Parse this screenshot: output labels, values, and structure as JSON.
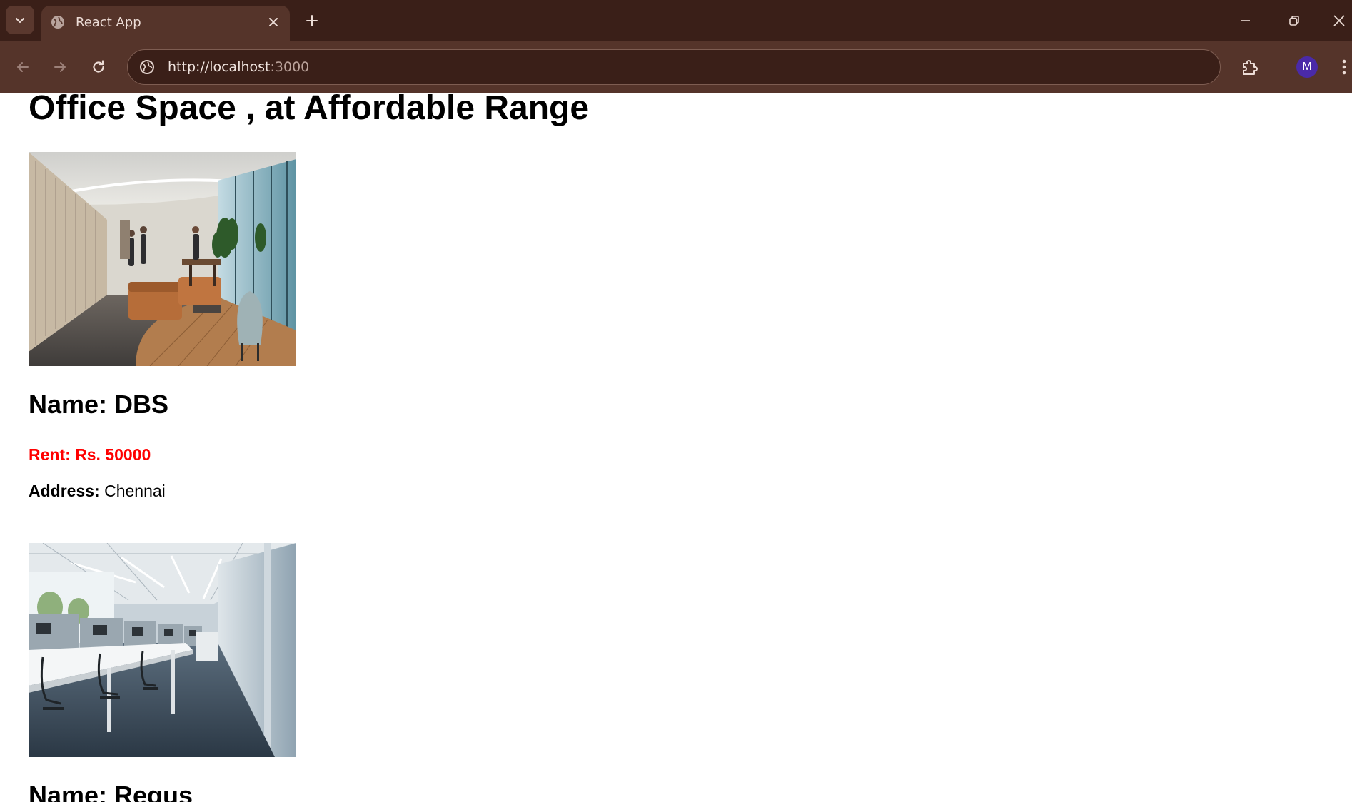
{
  "browser": {
    "tab_title": "React App",
    "url_host": "http://localhost",
    "url_port": ":3000",
    "profile_initial": "M"
  },
  "page": {
    "title": "Office Space , at Affordable Range"
  },
  "listings": [
    {
      "name": "Name: DBS",
      "rent": "Rent: Rs. 50000",
      "rent_color": "#ff0000",
      "address_label": "Address:",
      "address_value": "Chennai",
      "image": "office-lounge-photo"
    },
    {
      "name": "Name: Regus",
      "image": "open-plan-office-photo"
    }
  ]
}
